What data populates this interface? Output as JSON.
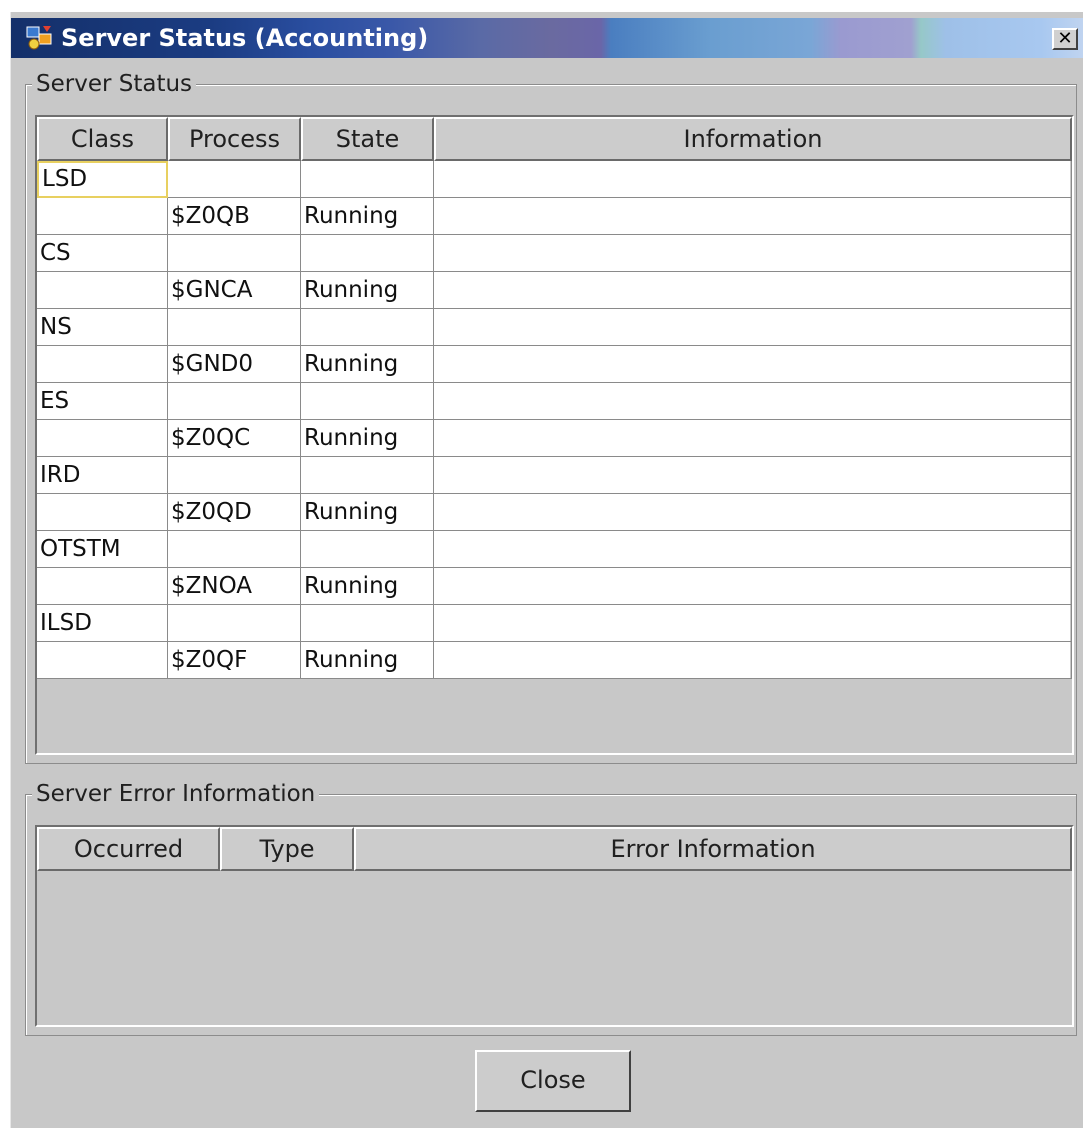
{
  "window": {
    "title": "Server Status (Accounting)",
    "close_glyph": "✕"
  },
  "server_status": {
    "legend": "Server Status",
    "columns": [
      "Class",
      "Process",
      "State",
      "Information"
    ],
    "rows": [
      {
        "class": "LSD",
        "process": "",
        "state": "",
        "information": ""
      },
      {
        "class": "",
        "process": "$Z0QB",
        "state": "Running",
        "information": ""
      },
      {
        "class": "CS",
        "process": "",
        "state": "",
        "information": ""
      },
      {
        "class": "",
        "process": "$GNCA",
        "state": "Running",
        "information": ""
      },
      {
        "class": "NS",
        "process": "",
        "state": "",
        "information": ""
      },
      {
        "class": "",
        "process": "$GND0",
        "state": "Running",
        "information": ""
      },
      {
        "class": "ES",
        "process": "",
        "state": "",
        "information": ""
      },
      {
        "class": "",
        "process": "$Z0QC",
        "state": "Running",
        "information": ""
      },
      {
        "class": "IRD",
        "process": "",
        "state": "",
        "information": ""
      },
      {
        "class": "",
        "process": "$Z0QD",
        "state": "Running",
        "information": ""
      },
      {
        "class": "OTSTM",
        "process": "",
        "state": "",
        "information": ""
      },
      {
        "class": "",
        "process": "$ZNOA",
        "state": "Running",
        "information": ""
      },
      {
        "class": "ILSD",
        "process": "",
        "state": "",
        "information": ""
      },
      {
        "class": "",
        "process": "$Z0QF",
        "state": "Running",
        "information": ""
      }
    ]
  },
  "server_error": {
    "legend": "Server Error Information",
    "columns": [
      "Occurred",
      "Type",
      "Error Information"
    ]
  },
  "footer": {
    "close_label": "Close"
  }
}
